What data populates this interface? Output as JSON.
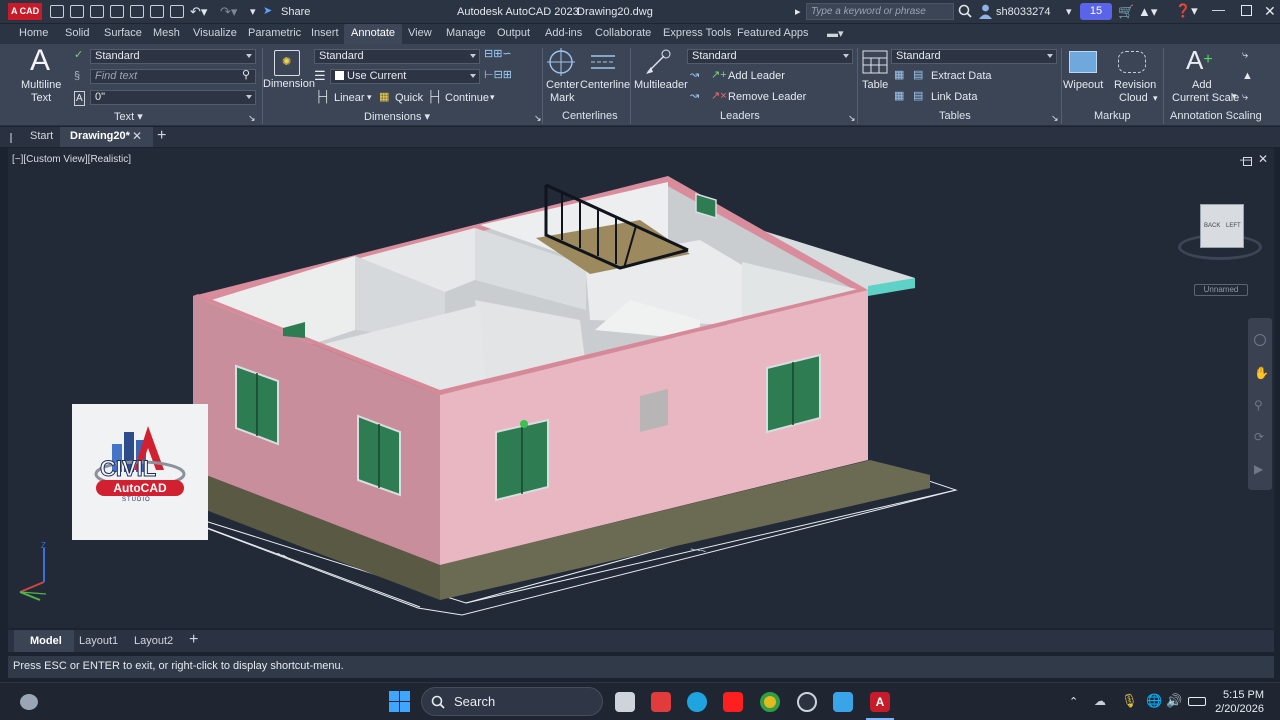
{
  "app": {
    "logo_text": "A CAD",
    "title": "Autodesk AutoCAD 2023",
    "filename": "Drawing20.dwg",
    "share": "Share",
    "search_placeholder": "Type a keyword or phrase",
    "user": "sh8033274",
    "notif_count": "15"
  },
  "menu_tabs": [
    "Home",
    "Solid",
    "Surface",
    "Mesh",
    "Visualize",
    "Parametric",
    "Insert",
    "Annotate",
    "View",
    "Manage",
    "Output",
    "Add-ins",
    "Collaborate",
    "Express Tools",
    "Featured Apps"
  ],
  "active_menu_tab": "Annotate",
  "ribbon": {
    "text": {
      "multiline": "Multiline",
      "multiline2": "Text",
      "style": "Standard",
      "find": "Find text",
      "height": "0\"",
      "title": "Text"
    },
    "dimensions": {
      "dimension": "Dimension",
      "style": "Standard",
      "layer": "Use Current",
      "linear": "Linear",
      "quick": "Quick",
      "continue": "Continue",
      "title": "Dimensions"
    },
    "centerlines": {
      "center": "Center",
      "mark": "Mark",
      "centerline": "Centerline",
      "title": "Centerlines"
    },
    "leaders": {
      "multileader": "Multileader",
      "style": "Standard",
      "add": "Add Leader",
      "remove": "Remove Leader",
      "title": "Leaders"
    },
    "tables": {
      "table": "Table",
      "style": "Standard",
      "extract": "Extract Data",
      "link": "Link Data",
      "title": "Tables"
    },
    "markup": {
      "wipeout": "Wipeout",
      "revision": "Revision",
      "cloud": "Cloud",
      "title": "Markup"
    },
    "scaling": {
      "add": "Add",
      "current_scale": "Current Scale",
      "title": "Annotation Scaling"
    }
  },
  "doc_tabs": {
    "start": "Start",
    "drawing": "Drawing20*"
  },
  "viewport": {
    "label": "[−][Custom View][Realistic]",
    "viewcube_back": "BACK",
    "viewcube_left": "LEFT",
    "unnamed": "Unnamed",
    "watermark_line1": "CIVIL",
    "watermark_line2": "AutoCAD",
    "watermark_line3": "STUDIO"
  },
  "layout_tabs": [
    "Model",
    "Layout1",
    "Layout2"
  ],
  "command_line": "Press ESC or ENTER to exit, or right-click to display shortcut-menu.",
  "taskbar": {
    "search": "Search",
    "time": "5:15 PM",
    "date": "2/20/2026"
  },
  "colors": {
    "wall_pink": "#e8b7c1",
    "wall_pink_dark": "#c98e9b",
    "window_green": "#2e7d52",
    "accent_tab": "#3d4758"
  }
}
